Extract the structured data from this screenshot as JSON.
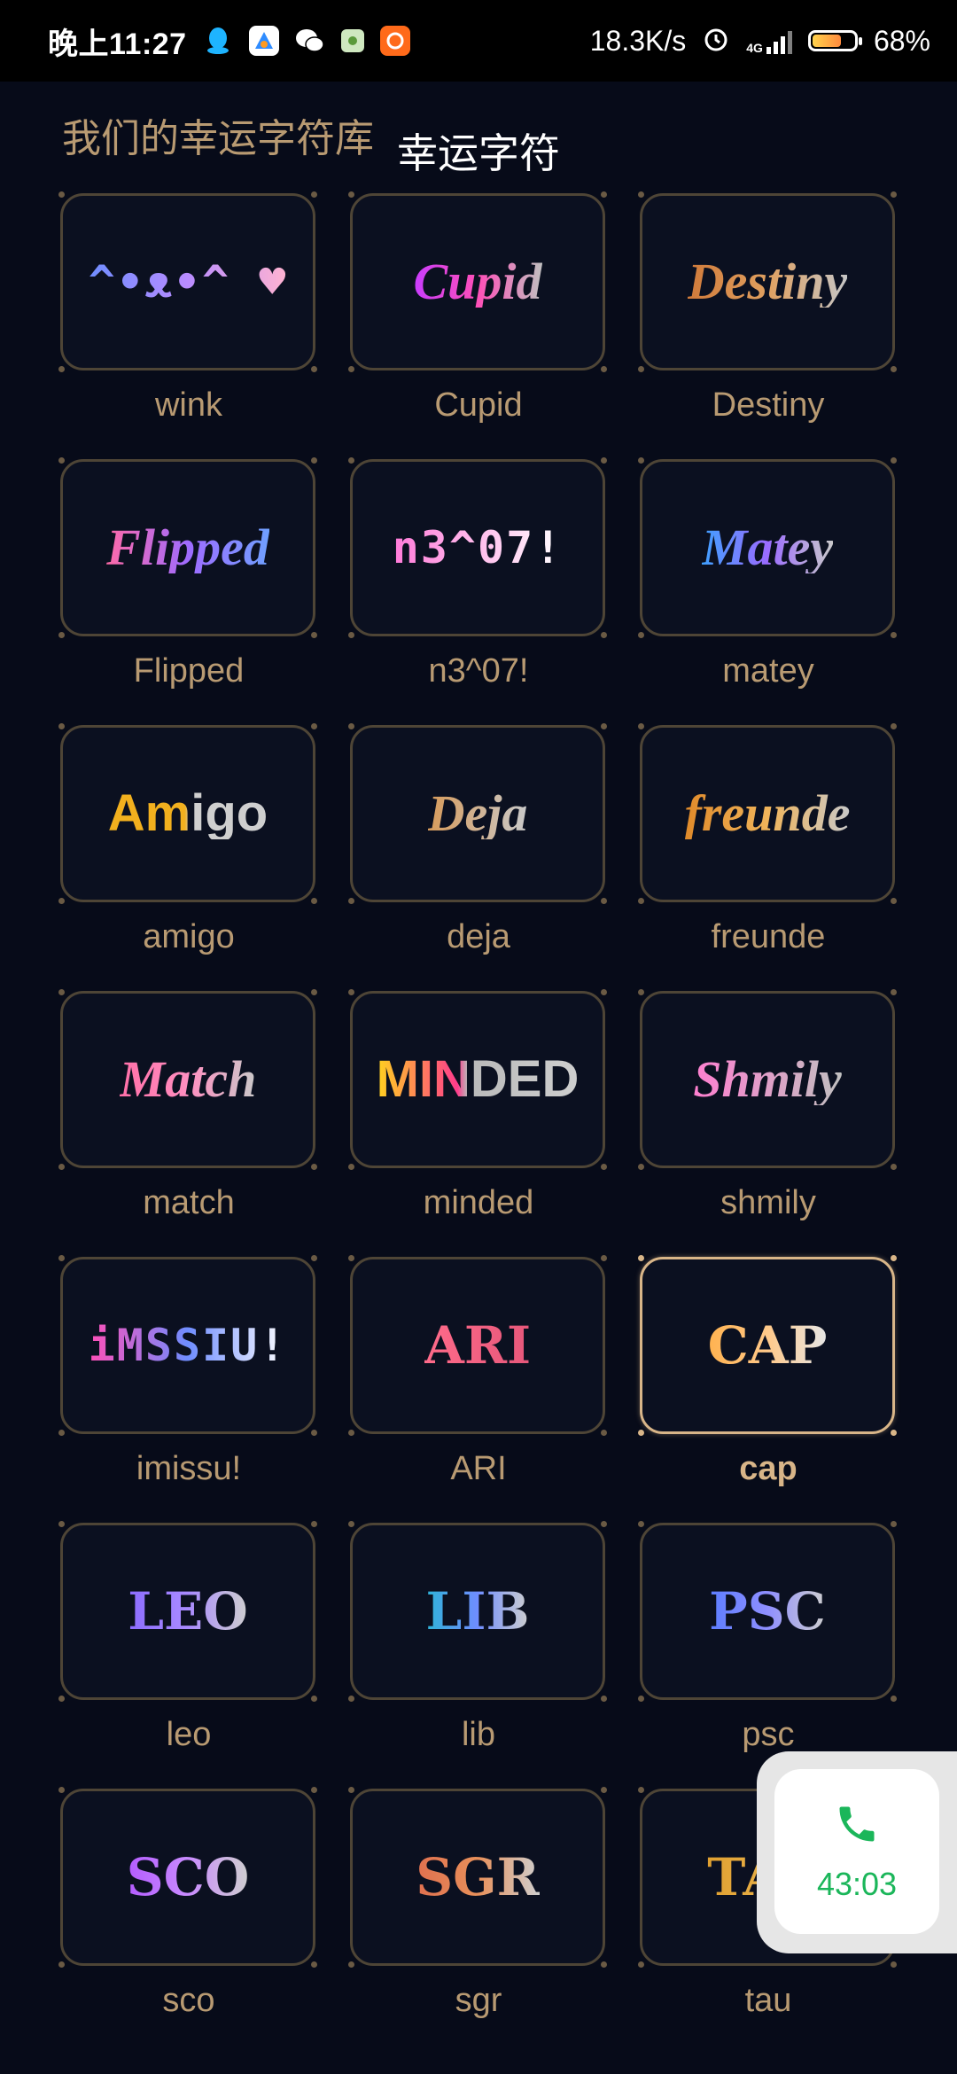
{
  "status_bar": {
    "time": "晚上11:27",
    "net_speed": "18.3K/s",
    "network": "4G",
    "battery_percent": "68%",
    "battery_level": 0.68,
    "app_icons": [
      "qq-icon",
      "app-store-icon",
      "wechat-icon",
      "green-app-icon",
      "orange-app-icon"
    ]
  },
  "header": {
    "subtitle": "我们的幸运字符库",
    "title": "幸运字符"
  },
  "items": [
    {
      "label": "wink",
      "art": "^•ᴥ•^ ♥",
      "style": "mono",
      "gradient": "linear-gradient(90deg,#6f8dff,#b98cff,#ffb3d1)",
      "selected": false
    },
    {
      "label": "Cupid",
      "art": "Cupid",
      "style": "script",
      "gradient": "linear-gradient(90deg,#c83cff,#ff4fb8,#c0c0c0)",
      "selected": false
    },
    {
      "label": "Destiny",
      "art": "Destiny",
      "style": "script",
      "gradient": "linear-gradient(90deg,#d07a3a,#e0a060,#c6c6c6)",
      "selected": false
    },
    {
      "label": "Flipped",
      "art": "Flipped",
      "style": "script",
      "gradient": "linear-gradient(90deg,#ff6aa8,#9f6bff,#6fa0ff)",
      "selected": false
    },
    {
      "label": "n3^07!",
      "art": "n3^07!",
      "style": "mono",
      "gradient": "linear-gradient(90deg,#ff7ad9,#ffffff)",
      "selected": false
    },
    {
      "label": "matey",
      "art": "Matey",
      "style": "script",
      "gradient": "linear-gradient(90deg,#3fa0ff,#9b6bff,#c9c9c9)",
      "selected": false
    },
    {
      "label": "amigo",
      "art": "Amigo",
      "style": "sans",
      "gradient": "linear-gradient(90deg,#f2b01e,#f2b01e 48%,#cfcfcf 52%,#cfcfcf)",
      "selected": false
    },
    {
      "label": "deja",
      "art": "Deja",
      "style": "script",
      "gradient": "linear-gradient(90deg,#d79b5b,#c9c9c9)",
      "selected": false
    },
    {
      "label": "freunde",
      "art": "freunde",
      "style": "script",
      "gradient": "linear-gradient(90deg,#e08a2a,#f0b45a,#c9c9c9)",
      "selected": false
    },
    {
      "label": "match",
      "art": "Match",
      "style": "script",
      "gradient": "linear-gradient(90deg,#ff6fa8,#ff8fc0,#c9c9c9)",
      "selected": false
    },
    {
      "label": "minded",
      "art": "MINDED",
      "style": "sans",
      "gradient": "linear-gradient(90deg,#ffd21f,#ff3c8c 40%,#b9b9b9 45%,#cfcfcf)",
      "selected": false
    },
    {
      "label": "shmily",
      "art": "Shmily",
      "style": "script",
      "gradient": "linear-gradient(90deg,#ff7fd0,#c0c0c0)",
      "selected": false
    },
    {
      "label": "imissu!",
      "art": "iMSSIU!",
      "style": "mono",
      "gradient": "linear-gradient(90deg,#ff4fb8,#6f8dff,#ffffff)",
      "selected": false
    },
    {
      "label": "ARI",
      "art": "ARI",
      "style": "serif",
      "gradient": "linear-gradient(90deg,#ff6b8a,#e6577a)",
      "selected": false
    },
    {
      "label": "cap",
      "art": "CAP",
      "style": "serif",
      "gradient": "linear-gradient(90deg,#ffb24f,#ffc98a,#e6e6e6)",
      "selected": true
    },
    {
      "label": "leo",
      "art": "LEO",
      "style": "serif",
      "gradient": "linear-gradient(90deg,#8b6bff,#a98bff,#cfcfcf)",
      "selected": false
    },
    {
      "label": "lib",
      "art": "LIB",
      "style": "serif",
      "gradient": "linear-gradient(90deg,#2fb3d9,#6f8dff,#cfcfcf)",
      "selected": false
    },
    {
      "label": "psc",
      "art": "PSC",
      "style": "serif",
      "gradient": "linear-gradient(90deg,#5c7dff,#8f8fff,#cfcfcf)",
      "selected": false
    },
    {
      "label": "sco",
      "art": "SCO",
      "style": "serif",
      "gradient": "linear-gradient(90deg,#b45cff,#c98bff,#cfcfcf)",
      "selected": false
    },
    {
      "label": "sgr",
      "art": "SGR",
      "style": "serif",
      "gradient": "linear-gradient(90deg,#e0704f,#e8905a,#cfcfcf)",
      "selected": false
    },
    {
      "label": "tau",
      "art": "TAU",
      "style": "serif",
      "gradient": "linear-gradient(90deg,#e0a030,#f0c060)",
      "selected": false
    }
  ],
  "call_widget": {
    "duration": "43:03",
    "icon": "phone-icon",
    "color": "#1bb65a"
  }
}
